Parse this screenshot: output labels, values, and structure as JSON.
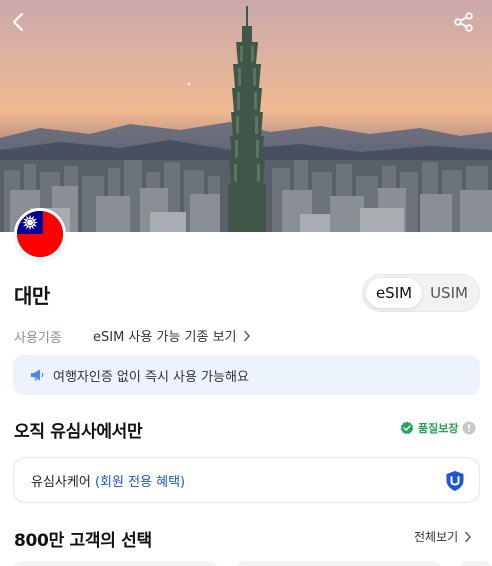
{
  "hero": {
    "back_icon": "chevron-left-icon",
    "share_icon": "share-icon"
  },
  "country": {
    "name": "대만",
    "flag_icon": "taiwan-flag-icon"
  },
  "sim_toggle": {
    "options": [
      "eSIM",
      "USIM"
    ],
    "selected": "eSIM"
  },
  "criteria": {
    "label": "사용기종",
    "link": "eSIM 사용 가능 기종 보기"
  },
  "notice": {
    "icon": "megaphone-icon",
    "text": "여행자인증 없이 즉시 사용 가능해요"
  },
  "only_section": {
    "title": "오직 유심사에서만",
    "quality_badge": "품질보장",
    "care_prefix": "유심사케어",
    "care_highlight": "(회원 전용 혜택)"
  },
  "popular_section": {
    "title": "800만 고객의 선택",
    "see_all": "전체보기"
  },
  "colors": {
    "accent_blue": "#1d56d6",
    "quality_green": "#25a35a",
    "notice_bg": "#edf3fd"
  }
}
